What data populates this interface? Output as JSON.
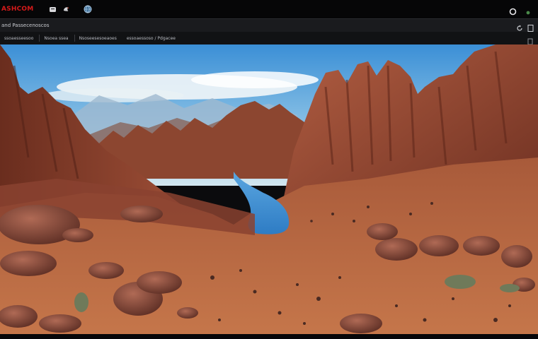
{
  "titlebar": {
    "brand": "ASHCOM",
    "icons": [
      "app-icon",
      "bird-icon",
      "globe-icon"
    ],
    "right_icons": [
      "shield-icon",
      "dot-icon"
    ]
  },
  "toolbar": {
    "address": "and Passecenoscos",
    "right_icons": [
      "refresh-icon",
      "page-icon"
    ]
  },
  "bookmarks": {
    "items": [
      {
        "label": "ssoaesseesoo"
      },
      {
        "label": "Nsoea ssea"
      },
      {
        "label": "Nsoseesesoeaoes"
      },
      {
        "label": "essoaessoso / Pdgacee"
      }
    ]
  },
  "viewport": {
    "scene": "desert-canyon-landscape"
  },
  "colors": {
    "brand": "#d61a1a",
    "sky_top": "#3b8fd6",
    "sky_bottom": "#bfe0f0",
    "rock": "#9a4a30",
    "sand": "#b8653f",
    "river": "#3d8fd0"
  }
}
